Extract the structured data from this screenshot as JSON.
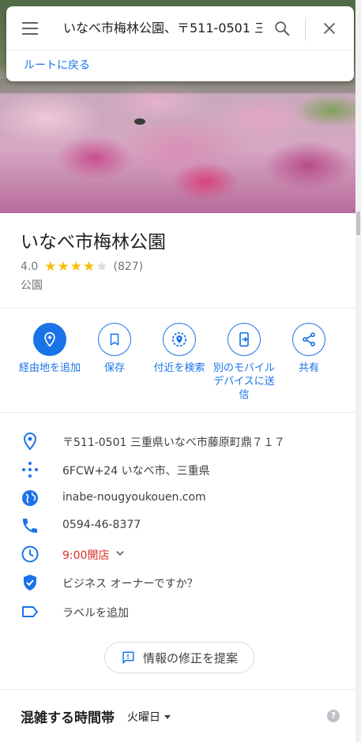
{
  "search": {
    "query": "いなべ市梅林公園、〒511-0501 三",
    "back_link": "ルートに戻る"
  },
  "place": {
    "name": "いなべ市梅林公園",
    "rating": "4.0",
    "rating_value": 4.0,
    "reviews": "(827)",
    "category": "公園"
  },
  "actions": [
    {
      "label": "経由地を追加",
      "icon": "add-waypoint-icon"
    },
    {
      "label": "保存",
      "icon": "bookmark-icon"
    },
    {
      "label": "付近を検索",
      "icon": "search-nearby-icon"
    },
    {
      "label": "別のモバイルデバイスに送信",
      "icon": "send-to-device-icon"
    },
    {
      "label": "共有",
      "icon": "share-icon"
    }
  ],
  "info": {
    "address": "〒511-0501 三重県いなべ市藤原町鼎７１７",
    "plus_code": "6FCW+24 いなべ市、三重県",
    "website": "inabe-nougyoukouen.com",
    "phone": "0594-46-8377",
    "hours": "9:00開店",
    "owner": "ビジネス オーナーですか？",
    "label": "ラベルを追加"
  },
  "suggest_edit": "情報の修正を提案",
  "popular_times": {
    "title": "混雑する時間帯",
    "day": "火曜日",
    "help": "?"
  },
  "colors": {
    "accent": "#1a73e8",
    "star": "#fbbc04",
    "open_status": "#d93025"
  }
}
